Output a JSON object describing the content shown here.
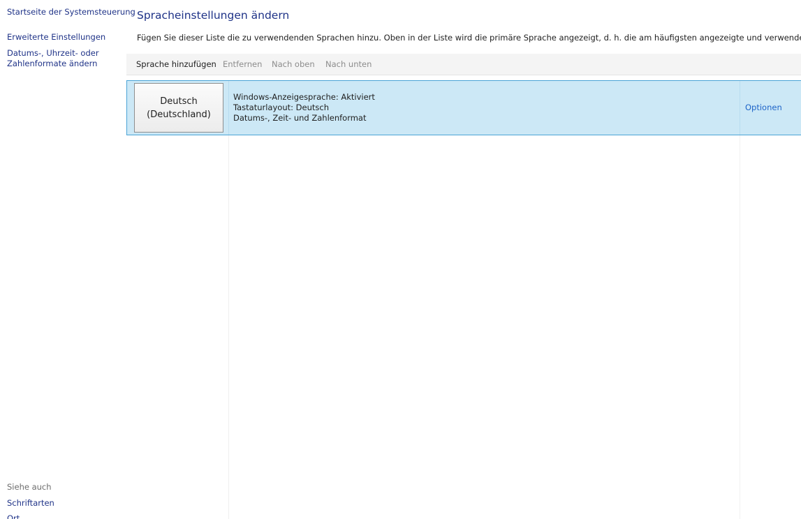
{
  "nav": {
    "home": "Startseite der Systemsteuerung",
    "advanced": "Erweiterte Einstellungen",
    "formats": "Datums-, Uhrzeit- oder Zahlenformate ändern"
  },
  "see_also": {
    "heading": "Siehe auch",
    "fonts": "Schriftarten",
    "location": "Ort"
  },
  "main": {
    "title": "Spracheinstellungen ändern",
    "description": "Fügen Sie dieser Liste die zu verwendenden Sprachen hinzu. Oben in der Liste wird die primäre Sprache angezeigt, d. h. die am häufigsten angezeigte und verwendete Sprache."
  },
  "toolbar": {
    "add": "Sprache hinzufügen",
    "remove": "Entfernen",
    "move_up": "Nach oben",
    "move_down": "Nach unten",
    "disabled_color": "#8c8c8c"
  },
  "languages": [
    {
      "name_line1": "Deutsch",
      "name_line2": "(Deutschland)",
      "details": [
        "Windows-Anzeigesprache: Aktiviert",
        "Tastaturlayout: Deutsch",
        "Datums-, Zeit- und Zahlenformat"
      ],
      "options": "Optionen",
      "selected": true
    }
  ],
  "colors": {
    "link": "#1e3287",
    "selection_bg": "#cce8f6",
    "selection_border": "#4aa3d6",
    "options_link": "#1e64c8"
  }
}
